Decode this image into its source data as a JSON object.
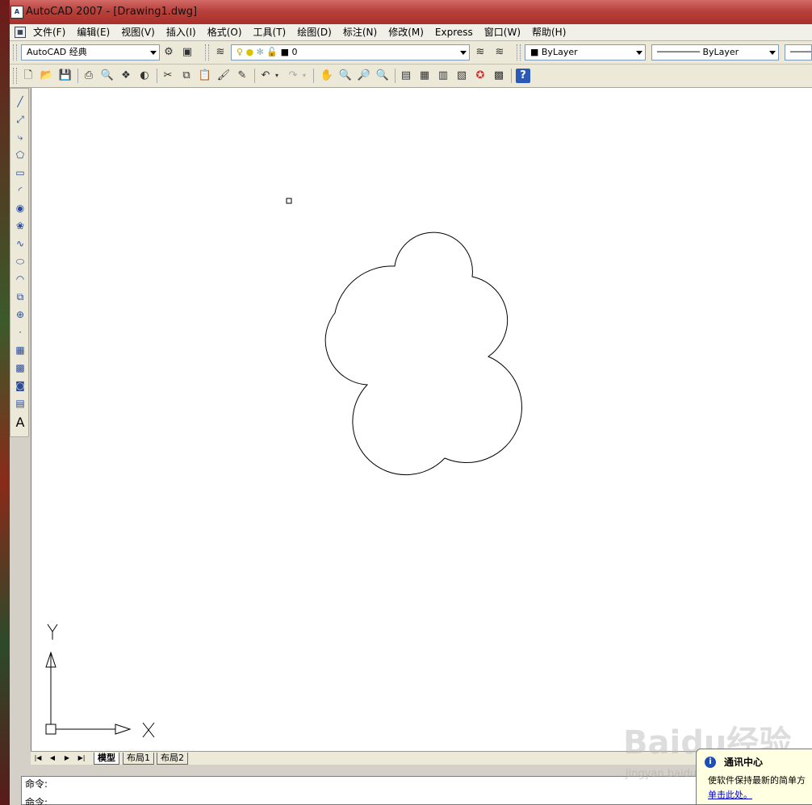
{
  "window": {
    "title": "AutoCAD 2007 - [Drawing1.dwg]",
    "app_icon_text": "A"
  },
  "menu": {
    "items": [
      "文件(F)",
      "编辑(E)",
      "视图(V)",
      "插入(I)",
      "格式(O)",
      "工具(T)",
      "绘图(D)",
      "标注(N)",
      "修改(M)",
      "Express",
      "窗口(W)",
      "帮助(H)"
    ]
  },
  "toolbar_properties": {
    "workspace": "AutoCAD 经典",
    "layer": "0",
    "color": "ByLayer",
    "linetype": "ByLayer"
  },
  "canvas": {
    "ucs_x_label": "X",
    "ucs_y_label": "Y"
  },
  "layout_tabs": [
    "模型",
    "布局1",
    "布局2"
  ],
  "command_line": {
    "line1": "命令:",
    "line2": "命令:"
  },
  "info_balloon": {
    "title": "通讯中心",
    "body": "使软件保持最新的简单方",
    "link": "单击此处。"
  },
  "watermark": {
    "text": "Baidu经验",
    "sub": "jingyan.baidu.com"
  }
}
